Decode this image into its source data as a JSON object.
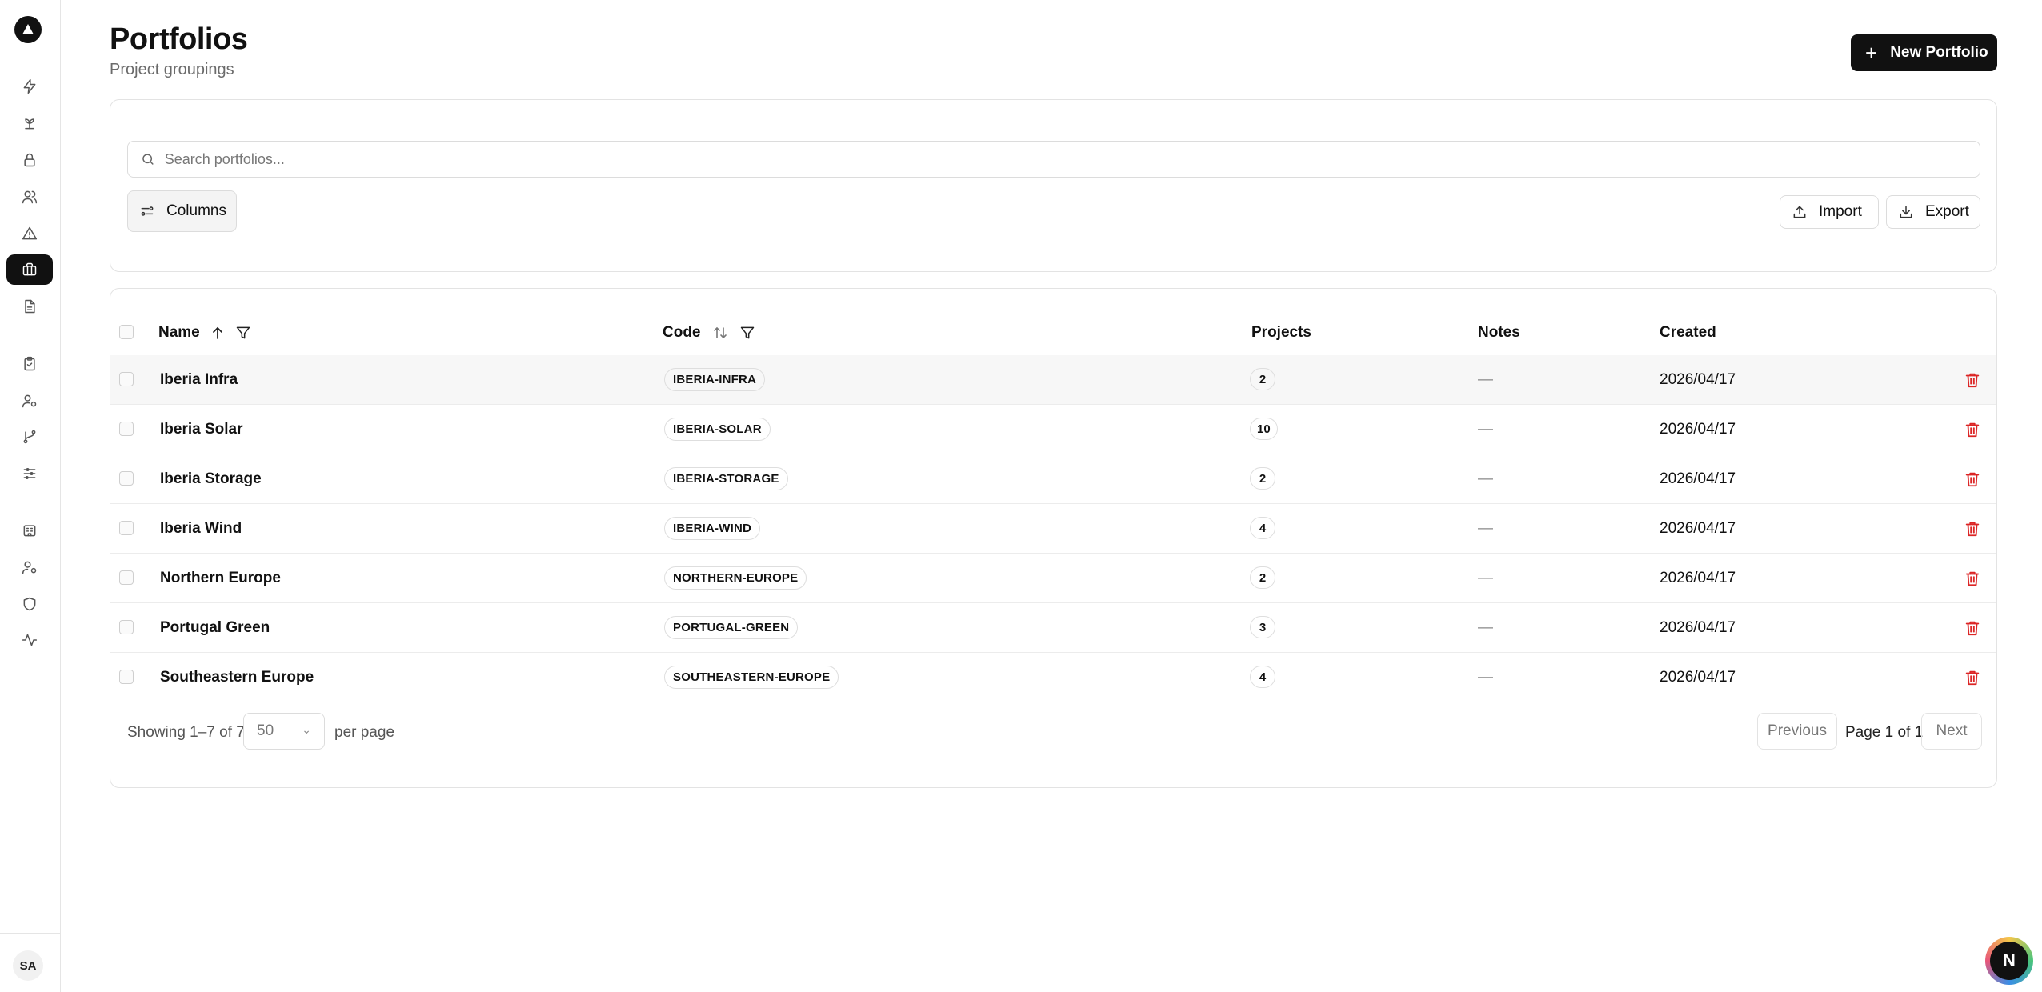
{
  "sidebar": {
    "logo": "logo-icon",
    "items": [
      {
        "icon": "bolt-icon",
        "active": false
      },
      {
        "icon": "plant-icon",
        "active": false
      },
      {
        "icon": "lock-icon",
        "active": false
      },
      {
        "icon": "users-icon",
        "active": false
      },
      {
        "icon": "alert-triangle-icon",
        "active": false
      },
      {
        "icon": "briefcase-icon",
        "active": true
      },
      {
        "icon": "document-icon",
        "active": false
      },
      {
        "icon": "clipboard-check-icon",
        "active": false
      },
      {
        "icon": "user-settings-icon",
        "active": false
      },
      {
        "icon": "git-branch-icon",
        "active": false
      },
      {
        "icon": "sliders-icon",
        "active": false
      },
      {
        "icon": "building-icon",
        "active": false
      },
      {
        "icon": "user-cog-icon",
        "active": false
      },
      {
        "icon": "shield-icon",
        "active": false
      },
      {
        "icon": "activity-icon",
        "active": false
      }
    ],
    "avatar": "SA"
  },
  "header": {
    "title": "Portfolios",
    "subtitle": "Project groupings",
    "new_button": "New Portfolio"
  },
  "toolbar": {
    "search_placeholder": "Search portfolios...",
    "columns_label": "Columns",
    "import_label": "Import",
    "export_label": "Export"
  },
  "table": {
    "columns": {
      "name": "Name",
      "code": "Code",
      "projects": "Projects",
      "notes": "Notes",
      "created": "Created"
    },
    "rows": [
      {
        "name": "Iberia Infra",
        "code": "IBERIA-INFRA",
        "projects": "2",
        "notes": "—",
        "created": "2026/04/17"
      },
      {
        "name": "Iberia Solar",
        "code": "IBERIA-SOLAR",
        "projects": "10",
        "notes": "—",
        "created": "2026/04/17"
      },
      {
        "name": "Iberia Storage",
        "code": "IBERIA-STORAGE",
        "projects": "2",
        "notes": "—",
        "created": "2026/04/17"
      },
      {
        "name": "Iberia Wind",
        "code": "IBERIA-WIND",
        "projects": "4",
        "notes": "—",
        "created": "2026/04/17"
      },
      {
        "name": "Northern Europe",
        "code": "NORTHERN-EUROPE",
        "projects": "2",
        "notes": "—",
        "created": "2026/04/17"
      },
      {
        "name": "Portugal Green",
        "code": "PORTUGAL-GREEN",
        "projects": "3",
        "notes": "—",
        "created": "2026/04/17"
      },
      {
        "name": "Southeastern Europe",
        "code": "SOUTHEASTERN-EUROPE",
        "projects": "4",
        "notes": "—",
        "created": "2026/04/17"
      }
    ]
  },
  "pagination": {
    "showing": "Showing 1–7 of 7",
    "per_page_value": "50",
    "per_page_label": "per page",
    "previous": "Previous",
    "page_info": "Page 1 of 1",
    "next": "Next"
  },
  "assistant": {
    "label": "N"
  },
  "colors": {
    "accent": "#111111",
    "danger": "#dc2626"
  }
}
